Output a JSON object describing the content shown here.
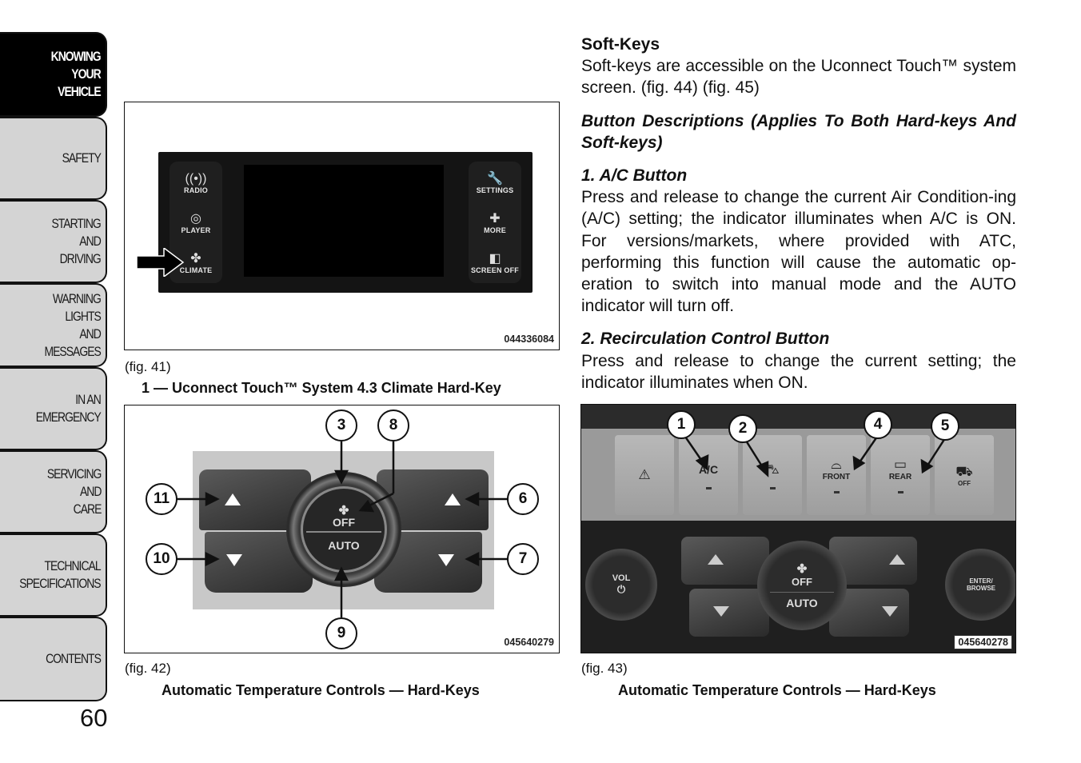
{
  "side_tabs": [
    {
      "label": "KNOWING\nYOUR\nVEHICLE",
      "active": true
    },
    {
      "label": "SAFETY",
      "active": false
    },
    {
      "label": "STARTING\nAND\nDRIVING",
      "active": false
    },
    {
      "label": "WARNING\nLIGHTS\nAND\nMESSAGES",
      "active": false
    },
    {
      "label": "IN AN\nEMERGENCY",
      "active": false
    },
    {
      "label": "SERVICING\nAND\nCARE",
      "active": false
    },
    {
      "label": "TECHNICAL\nSPECIFICATIONS",
      "active": false
    },
    {
      "label": "CONTENTS",
      "active": false
    }
  ],
  "page_number": "60",
  "figures": {
    "fig41": {
      "label": "(fig. 41)",
      "caption": "1 — Uconnect Touch™ System 4.3 Climate Hard-Key",
      "code": "044336084",
      "left_keys": [
        {
          "icon": "radio-antenna-icon",
          "glyph": "((•))",
          "label": "RADIO"
        },
        {
          "icon": "player-disc-icon",
          "glyph": "◎",
          "label": "PLAYER"
        },
        {
          "icon": "fan-icon",
          "glyph": "✤",
          "label": "CLIMATE"
        }
      ],
      "right_keys": [
        {
          "icon": "wrench-icon",
          "glyph": "🔧",
          "label": "SETTINGS"
        },
        {
          "icon": "plus-icon",
          "glyph": "✚",
          "label": "MORE"
        },
        {
          "icon": "screen-off-icon",
          "glyph": "◧",
          "label": "SCREEN OFF"
        }
      ]
    },
    "fig42": {
      "label": "(fig. 42)",
      "caption": "Automatic Temperature Controls — Hard-Keys",
      "code": "045640279",
      "knob_top": "OFF",
      "knob_bottom": "AUTO",
      "callouts": [
        "3",
        "8",
        "11",
        "6",
        "10",
        "7",
        "9"
      ]
    },
    "fig43": {
      "label": "(fig. 43)",
      "caption": "Automatic Temperature Controls — Hard-Keys",
      "code": "045640278",
      "keys": [
        {
          "icon": "hazard-triangle-icon",
          "glyph": "⚠",
          "label": ""
        },
        {
          "icon": "ac-icon",
          "glyph": "A/C",
          "label": ""
        },
        {
          "icon": "recirculation-car-icon",
          "glyph": "⛍",
          "label": ""
        },
        {
          "icon": "front-defrost-icon",
          "glyph": "⌓",
          "label": "FRONT"
        },
        {
          "icon": "rear-defrost-icon",
          "glyph": "▭",
          "label": "REAR"
        },
        {
          "icon": "traction-off-icon",
          "glyph": "⛟",
          "label": "OFF"
        }
      ],
      "callouts": [
        "1",
        "2",
        "4",
        "5"
      ],
      "vol_label": "VOL",
      "knob_top": "OFF",
      "knob_bottom": "AUTO",
      "tune_label": "ENTER/\nBROWSE"
    }
  },
  "text": {
    "soft_keys_heading": "Soft-Keys",
    "soft_keys_body": "Soft-keys are accessible on the Uconnect Touch™ system screen. (fig. 44) (fig. 45)",
    "button_desc_heading": "Button Descriptions (Applies To Both Hard-keys And Soft-keys)",
    "ac_heading": "1. A/C Button",
    "ac_body": "Press and release to change the current Air Condition-ing (A/C) setting; the indicator illuminates when A/C is ON. For versions/markets, where provided with ATC, performing this function will cause the automatic op-eration to switch into manual mode and the AUTO indicator will turn off.",
    "recirc_heading": "2. Recirculation Control Button",
    "recirc_body": "Press and release to change the current setting; the indicator illuminates when ON."
  }
}
